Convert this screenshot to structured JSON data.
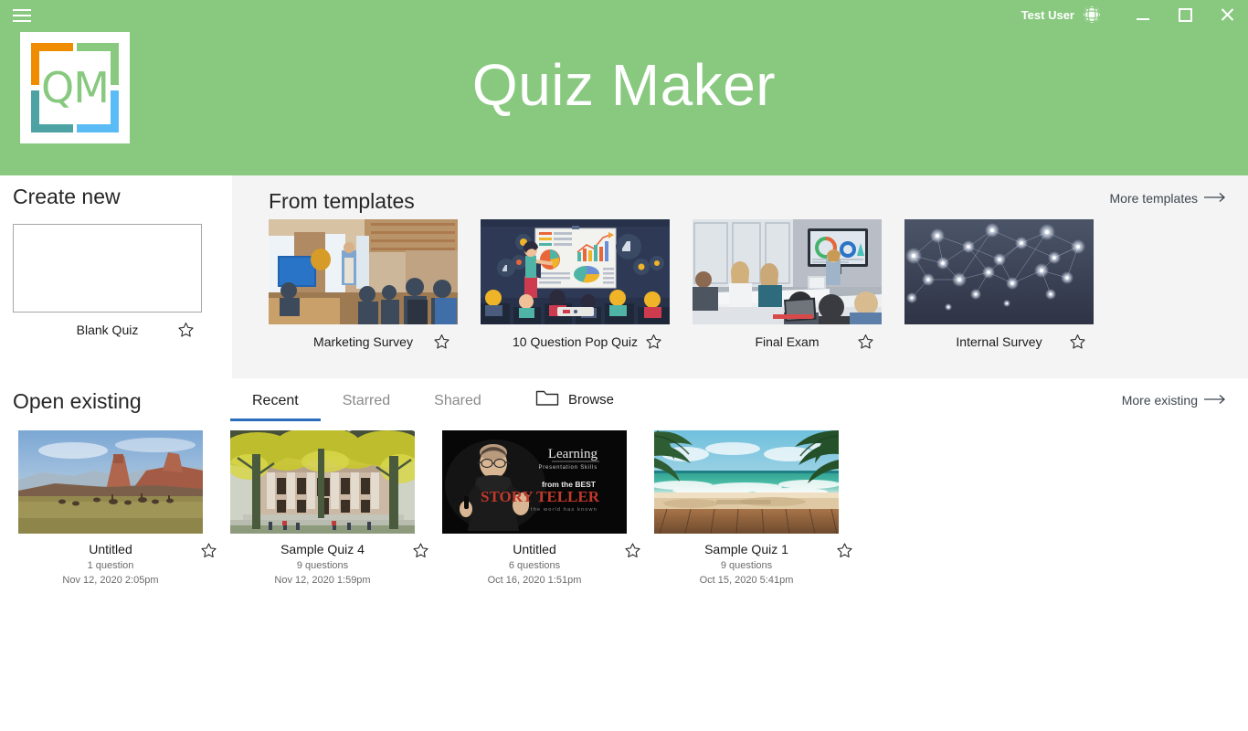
{
  "window": {
    "user_name": "Test User",
    "avatar_icon": "globe-avatar-icon",
    "menu_icon": "hamburger-menu-icon",
    "minimize_label": "Minimize",
    "maximize_label": "Maximize",
    "close_label": "Close",
    "accent_color": "#88c97f",
    "panel_color": "#f4f4f4",
    "tab_active_color": "#2a6ebb"
  },
  "app": {
    "title": "Quiz Maker",
    "logo_text": "QM",
    "logo_colors": {
      "top_left": "#f08c00",
      "top_right": "#88c97f",
      "bottom_left": "#4da3a3",
      "bottom_right": "#5bbcf5"
    }
  },
  "create_new": {
    "heading": "Create new",
    "blank_label": "Blank Quiz",
    "star_icon": "star-outline-icon"
  },
  "templates": {
    "heading": "From templates",
    "more_label": "More templates",
    "more_arrow": "arrow-right-icon",
    "items": [
      {
        "label": "Marketing Survey",
        "thumb": "office-presentation-photo",
        "star_icon": "star-outline-icon"
      },
      {
        "label": "10 Question Pop Quiz",
        "thumb": "presenter-charts-illustration",
        "star_icon": "star-outline-icon"
      },
      {
        "label": "Final Exam",
        "thumb": "conference-room-photo",
        "star_icon": "star-outline-icon"
      },
      {
        "label": "Internal Survey",
        "thumb": "network-nodes-graphic",
        "star_icon": "star-outline-icon"
      }
    ]
  },
  "open_existing": {
    "heading": "Open existing",
    "tabs": [
      {
        "label": "Recent",
        "active": true
      },
      {
        "label": "Starred",
        "active": false
      },
      {
        "label": "Shared",
        "active": false
      }
    ],
    "browse_label": "Browse",
    "browse_icon": "folder-icon",
    "more_label": "More existing",
    "more_arrow": "arrow-right-icon",
    "items": [
      {
        "title": "Untitled",
        "questions": "1 question",
        "modified": "Nov 12, 2020 2:05pm",
        "thumb": "desert-mesa-landscape-photo",
        "star_icon": "star-outline-icon"
      },
      {
        "title": "Sample Quiz 4",
        "questions": "9 questions",
        "modified": "Nov 12, 2020 1:59pm",
        "thumb": "autumn-campus-building-photo",
        "star_icon": "star-outline-icon"
      },
      {
        "title": "Untitled",
        "questions": "6 questions",
        "modified": "Oct 16, 2020 1:51pm",
        "thumb": "storyteller-presenter-photo",
        "star_icon": "star-outline-icon",
        "thumb_text": {
          "line1": "Learning",
          "line2": "Presentation Skills",
          "line3": "from the BEST",
          "line4": "STORY TELLER",
          "line5": "the world has known"
        }
      },
      {
        "title": "Sample Quiz 1",
        "questions": "9 questions",
        "modified": "Oct 15, 2020 5:41pm",
        "thumb": "tropical-beach-photo",
        "star_icon": "star-outline-icon"
      }
    ]
  }
}
